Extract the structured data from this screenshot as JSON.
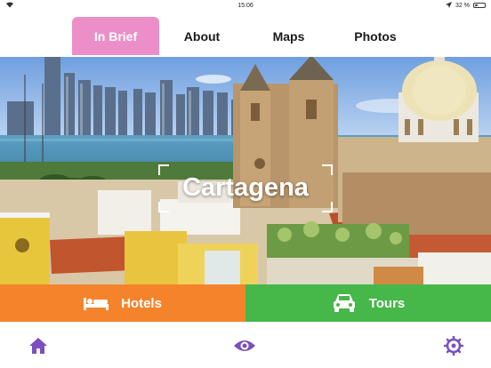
{
  "status_bar": {
    "carrier_icon": "wifi-icon",
    "time": "15:06",
    "location_icon": "location-arrow-icon",
    "battery_percent_label": "32 %",
    "battery_level": 0.32
  },
  "tabs": [
    {
      "label": "In Brief",
      "active": true
    },
    {
      "label": "About",
      "active": false
    },
    {
      "label": "Maps",
      "active": false
    },
    {
      "label": "Photos",
      "active": false
    }
  ],
  "hero": {
    "title": "Cartagena"
  },
  "actions": {
    "hotels_label": "Hotels",
    "hotels_icon": "bed-icon",
    "tours_label": "Tours",
    "tours_icon": "car-icon"
  },
  "bottom_nav": {
    "items": [
      {
        "icon": "home-icon"
      },
      {
        "icon": "eye-icon"
      },
      {
        "icon": "gear-icon"
      }
    ]
  },
  "colors": {
    "active_tab": "#ec8fc8",
    "hotels": "#f5832b",
    "tours": "#46b749",
    "nav_icon": "#7b4fbf"
  }
}
